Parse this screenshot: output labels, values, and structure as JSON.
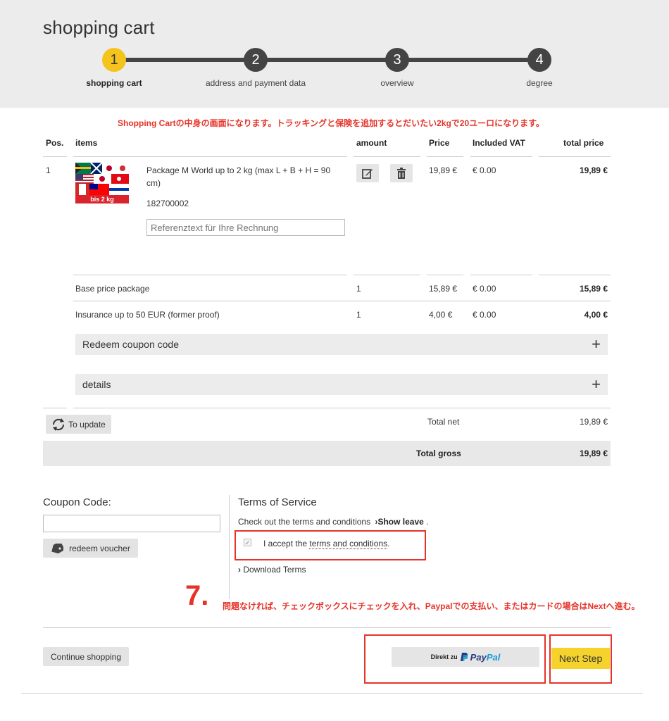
{
  "page": {
    "title": "shopping cart"
  },
  "steps": [
    {
      "number": "1",
      "label": "shopping cart",
      "active": true
    },
    {
      "number": "2",
      "label": "address and payment data",
      "active": false
    },
    {
      "number": "3",
      "label": "overview",
      "active": false
    },
    {
      "number": "4",
      "label": "degree",
      "active": false
    }
  ],
  "annotations": {
    "top_note": "Shopping Cartの中身の画面になります。トラッキングと保険を追加するとだいたい2kgで20ユーロになります。",
    "step_number": "7.",
    "bottom_note": "問題なければ、チェックボックスにチェックを入れ、Paypalでの支払い、またはカードの場合はNextへ進む。"
  },
  "table": {
    "headers": {
      "pos": "Pos.",
      "items": "items",
      "amount": "amount",
      "price": "Price",
      "vat": "Included VAT",
      "total": "total price"
    },
    "item": {
      "pos": "1",
      "image_band": "bis 2 kg",
      "name": "Package M World up to 2 kg (max L + B + H = 90 cm)",
      "sku": "182700002",
      "reference_placeholder": "Referenztext für Ihre Rechnung",
      "price": "19,89 €",
      "vat": "€ 0.00",
      "total": "19,89 €"
    },
    "sub_rows": [
      {
        "label": "Base price package",
        "amount": "1",
        "price": "15,89 €",
        "vat": "€ 0.00",
        "total": "15,89 €"
      },
      {
        "label": "Insurance up to 50 EUR (former proof)",
        "amount": "1",
        "price": "4,00 €",
        "vat": "€ 0.00",
        "total": "4,00 €"
      }
    ],
    "accordions": {
      "coupon": "Redeem coupon code",
      "details": "details",
      "expand_symbol": "+"
    },
    "update_button": "To update",
    "total_net_label": "Total net",
    "total_net_value": "19,89 €",
    "total_gross_label": "Total gross",
    "total_gross_value": "19,89 €"
  },
  "coupon": {
    "label": "Coupon Code:",
    "value": "",
    "redeem_button": "redeem voucher"
  },
  "tos": {
    "title": "Terms of Service",
    "check_text": "Check out the terms and conditions",
    "show_leave": "Show leave",
    "period": ".",
    "accept_prefix": "I accept the",
    "accept_link": "terms and conditions",
    "accept_suffix": ".",
    "download": "Download Terms",
    "checked": true
  },
  "footer": {
    "continue_button": "Continue shopping",
    "paypal_prefix": "Direkt zu",
    "paypal_brand_1": "Pay",
    "paypal_brand_2": "Pal",
    "next_button": "Next Step"
  },
  "colors": {
    "accent_yellow": "#f5c41c",
    "annotation_red": "#e63329",
    "paypal_dark": "#253b80",
    "paypal_light": "#179bd7"
  }
}
